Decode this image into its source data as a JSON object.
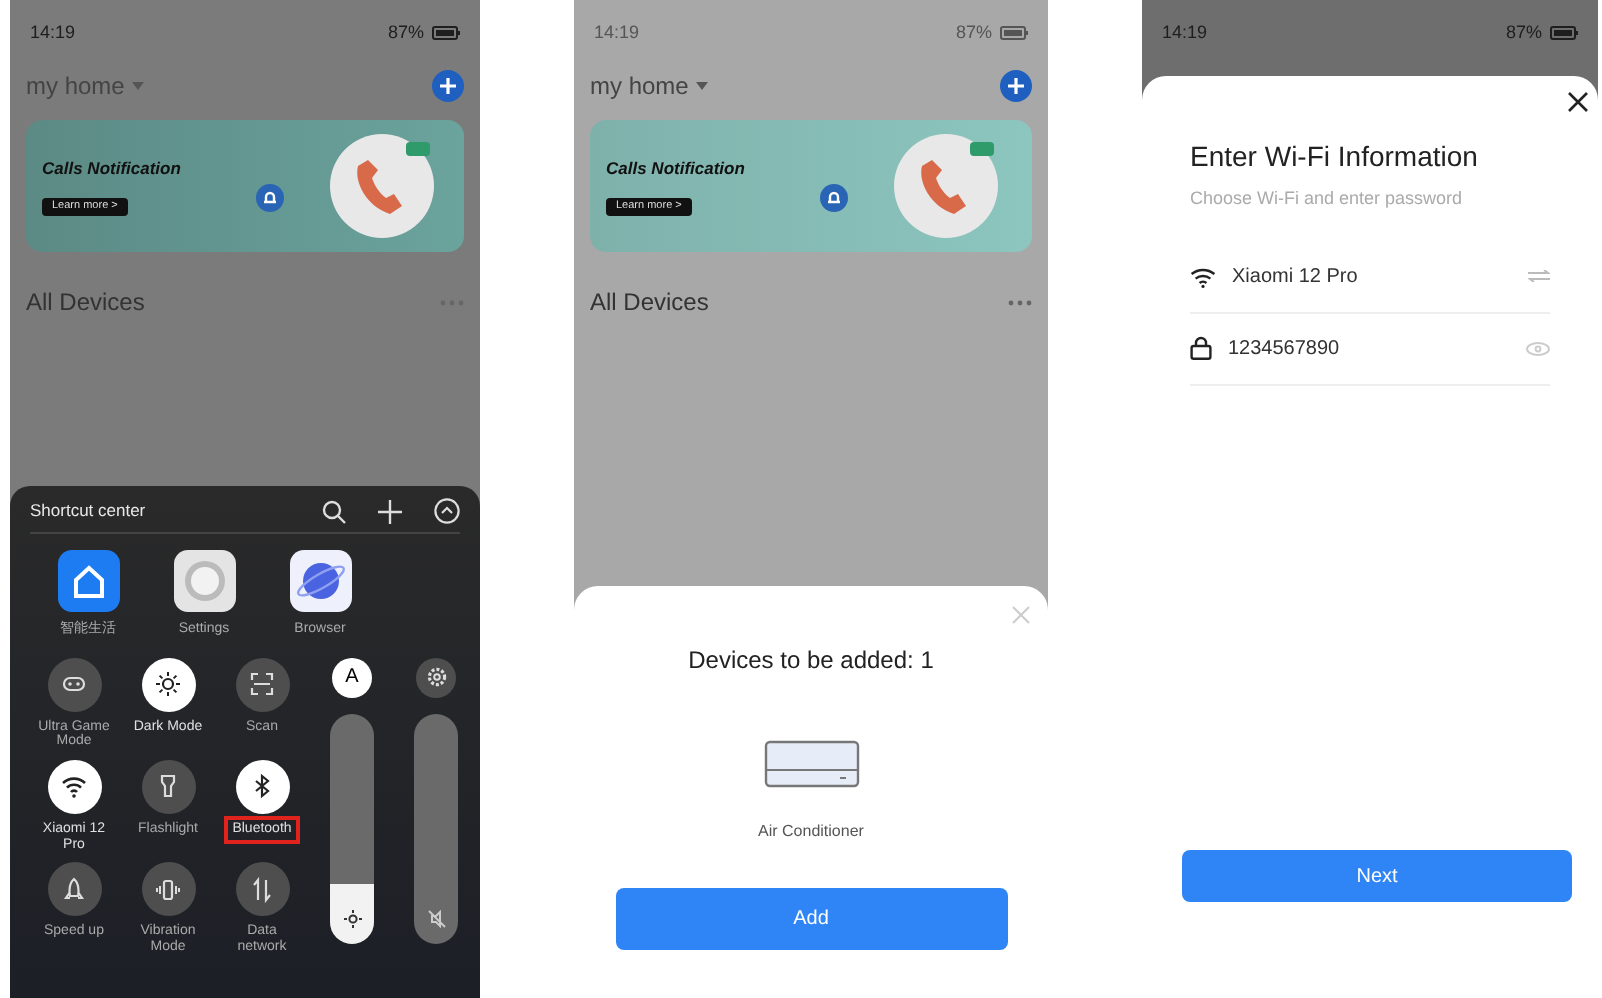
{
  "screens": [
    {
      "kind": "shortcuts",
      "status": {
        "time": "14:19",
        "battery": "87%"
      },
      "home": {
        "title": "my home",
        "banner": {
          "title": "Calls Notification",
          "button": "Learn more >"
        },
        "section": "All Devices"
      },
      "panel": {
        "title": "Shortcut center",
        "apps": [
          {
            "label": "智能生活"
          },
          {
            "label": "Settings"
          },
          {
            "label": "Browser"
          }
        ],
        "toggles": [
          {
            "label": "Ultra Game Mode",
            "on": false,
            "highlighted": false
          },
          {
            "label": "Dark Mode",
            "on": true,
            "highlighted": false
          },
          {
            "label": "Scan",
            "on": false,
            "highlighted": false
          },
          {
            "label": "Xiaomi 12 Pro",
            "on": true,
            "highlighted": false
          },
          {
            "label": "Flashlight",
            "on": false,
            "highlighted": false
          },
          {
            "label": "Bluetooth",
            "on": true,
            "highlighted": true
          },
          {
            "label": "Speed up",
            "on": false,
            "highlighted": false
          },
          {
            "label": "Vibration Mode",
            "on": false,
            "highlighted": false
          },
          {
            "label": "Data network",
            "on": false,
            "highlighted": false
          }
        ],
        "sliders": [
          {
            "kind": "brightness",
            "button": "A",
            "level": 0.26
          },
          {
            "kind": "volume",
            "level": 0
          }
        ]
      }
    },
    {
      "kind": "add",
      "status": {
        "time": "14:19",
        "battery": "87%"
      },
      "home": {
        "title": "my home",
        "banner": {
          "title": "Calls Notification",
          "button": "Learn more >"
        },
        "section": "All Devices"
      },
      "sheet": {
        "title": "Devices to be added: 1",
        "device": "Air Conditioner",
        "button": "Add"
      }
    },
    {
      "kind": "wifi",
      "status": {
        "time": "14:19",
        "battery": "87%"
      },
      "sheet": {
        "title": "Enter Wi-Fi Information",
        "subtitle": "Choose Wi-Fi and enter password",
        "network": "Xiaomi 12 Pro",
        "password": "1234567890",
        "button": "Next"
      }
    }
  ]
}
